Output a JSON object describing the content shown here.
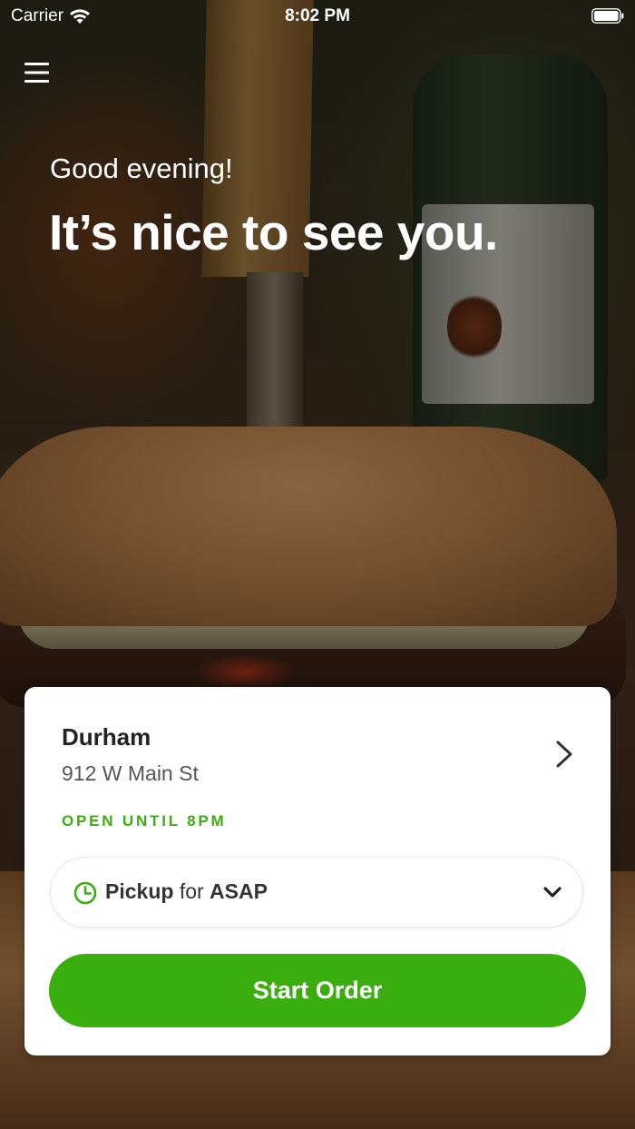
{
  "status_bar": {
    "carrier": "Carrier",
    "time": "8:02 PM",
    "wifi_icon": "wifi-icon",
    "battery_icon": "battery-icon"
  },
  "header": {
    "menu_icon": "hamburger-menu-icon",
    "greeting": "Good evening!",
    "headline": "It’s nice to see you."
  },
  "location": {
    "name": "Durham",
    "address": "912 W Main St",
    "hours_status": "OPEN UNTIL 8PM",
    "chevron_icon": "chevron-right-icon"
  },
  "order_type": {
    "method": "Pickup",
    "connector": "for",
    "time": "ASAP",
    "clock_icon": "clock-icon",
    "dropdown_icon": "chevron-down-icon"
  },
  "actions": {
    "start_order_label": "Start Order"
  },
  "colors": {
    "accent": "#3aae0e",
    "card_background": "#ffffff",
    "text_primary": "#222222",
    "text_secondary": "#555555"
  }
}
